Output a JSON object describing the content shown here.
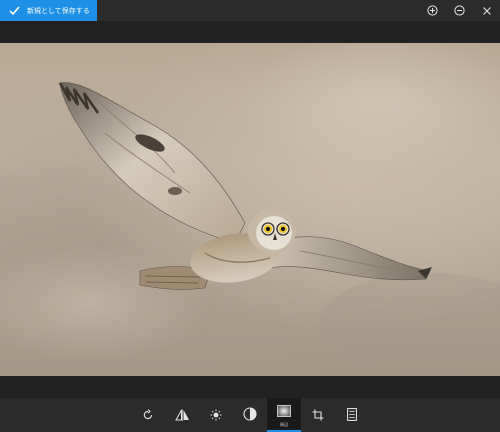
{
  "topbar": {
    "save_label": "新規として保存する",
    "icons": [
      "zoom-in-icon",
      "zoom-out-icon",
      "close-icon"
    ]
  },
  "toolbar": {
    "tools": [
      {
        "icon": "rotate-icon"
      },
      {
        "icon": "flip-icon"
      },
      {
        "icon": "brightness-icon"
      },
      {
        "icon": "contrast-icon"
      },
      {
        "icon": "vignette-icon",
        "label": "周辺",
        "active": true
      },
      {
        "icon": "crop-icon"
      },
      {
        "icon": "aspect-icon"
      }
    ]
  },
  "colors": {
    "accent": "#1d8fe6",
    "topbar": "#2b2b2b",
    "background": "#202020"
  }
}
